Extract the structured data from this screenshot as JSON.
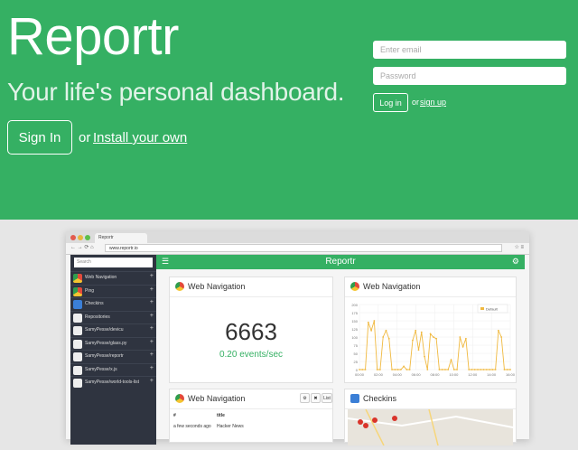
{
  "brand": "Reportr",
  "tagline": "Your life's personal dashboard.",
  "signin_label": "Sign In",
  "or_text": "or",
  "install_label": "Install your own",
  "login": {
    "email_placeholder": "Enter email",
    "password_placeholder": "Password",
    "login_label": "Log in",
    "or_text": "or",
    "signup_label": "sign up"
  },
  "colors": {
    "accent": "#35b063",
    "sidebar": "#2f3440",
    "chart_line": "#f0b940"
  },
  "browser": {
    "tab_title": "Reportr",
    "url": "www.reportr.io"
  },
  "app": {
    "title": "Reportr",
    "search_placeholder": "Search",
    "sidebar_items": [
      {
        "label": "Web Navigation",
        "icon": "chrome-icon"
      },
      {
        "label": "Ping",
        "icon": "chrome-icon"
      },
      {
        "label": "Checkins",
        "icon": "checkin-icon"
      },
      {
        "label": "Repositories",
        "icon": "github-icon"
      },
      {
        "label": "SamyPesse/devicu",
        "icon": "github-icon"
      },
      {
        "label": "SamyPesse/glass.py",
        "icon": "github-icon"
      },
      {
        "label": "SamyPesse/reportr",
        "icon": "github-icon"
      },
      {
        "label": "SamyPesse/x.js",
        "icon": "github-icon"
      },
      {
        "label": "SamyPesse/world-tools-list",
        "icon": "github-icon"
      }
    ],
    "cards": {
      "counter": {
        "title": "Web Navigation",
        "value": "6663",
        "rate": "0.20 events/sec"
      },
      "chart": {
        "title": "Web Navigation",
        "legend": "Default",
        "yticks": [
          "200",
          "175",
          "150",
          "125",
          "100",
          "75",
          "50",
          "25",
          "0"
        ],
        "xticks": [
          "00:00",
          "02:00",
          "04:00",
          "06:00",
          "08:00",
          "10:00",
          "12:00",
          "14:00",
          "16:00"
        ]
      },
      "table": {
        "title": "Web Navigation",
        "btn_list": "List",
        "col_hash": "#",
        "col_title": "title",
        "row1_a": "a few seconds ago",
        "row1_b": "Hacker News"
      },
      "checkins": {
        "title": "Checkins"
      }
    }
  },
  "chart_data": {
    "type": "line",
    "series": [
      {
        "name": "Default",
        "values": [
          0,
          0,
          0,
          145,
          120,
          150,
          0,
          0,
          100,
          120,
          95,
          0,
          0,
          0,
          0,
          10,
          0,
          0,
          90,
          120,
          60,
          115,
          40,
          0,
          110,
          100,
          95,
          0,
          0,
          0,
          0,
          30,
          0,
          0,
          100,
          70,
          95,
          0,
          0,
          0,
          0,
          0,
          0,
          0,
          0,
          0,
          0,
          120,
          100,
          0,
          0,
          0
        ]
      }
    ],
    "ylim": [
      0,
      200
    ]
  }
}
